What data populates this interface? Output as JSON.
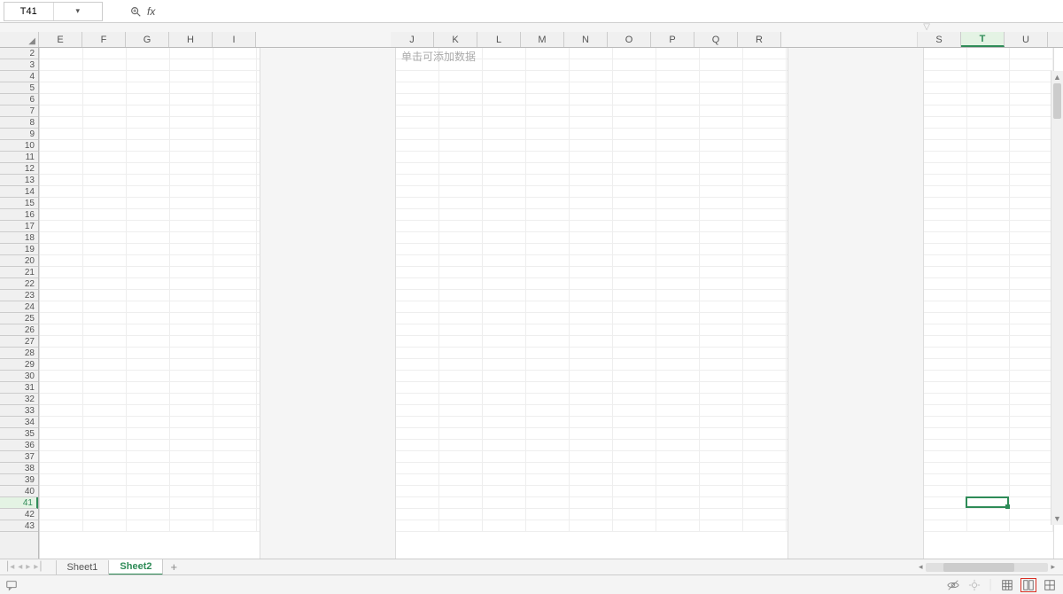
{
  "formula_bar": {
    "cell_ref": "T41",
    "fx_label": "fx",
    "value": ""
  },
  "columns_block1": [
    "E",
    "F",
    "G",
    "H",
    "I"
  ],
  "columns_block2": [
    "J",
    "K",
    "L",
    "M",
    "N",
    "O",
    "P",
    "Q",
    "R"
  ],
  "columns_block3": [
    "S",
    "T",
    "U"
  ],
  "active_column": "T",
  "rows": [
    2,
    3,
    4,
    5,
    6,
    7,
    8,
    9,
    10,
    11,
    12,
    13,
    14,
    15,
    16,
    17,
    18,
    19,
    20,
    21,
    22,
    23,
    24,
    25,
    26,
    27,
    28,
    29,
    30,
    31,
    32,
    33,
    34,
    35,
    36,
    37,
    38,
    39,
    40,
    41,
    42,
    43
  ],
  "active_row": 41,
  "placeholder_block2": "单击可添加数据",
  "sheets": {
    "tabs": [
      "Sheet1",
      "Sheet2"
    ],
    "active": "Sheet2"
  },
  "status": {
    "add_label": "+"
  }
}
